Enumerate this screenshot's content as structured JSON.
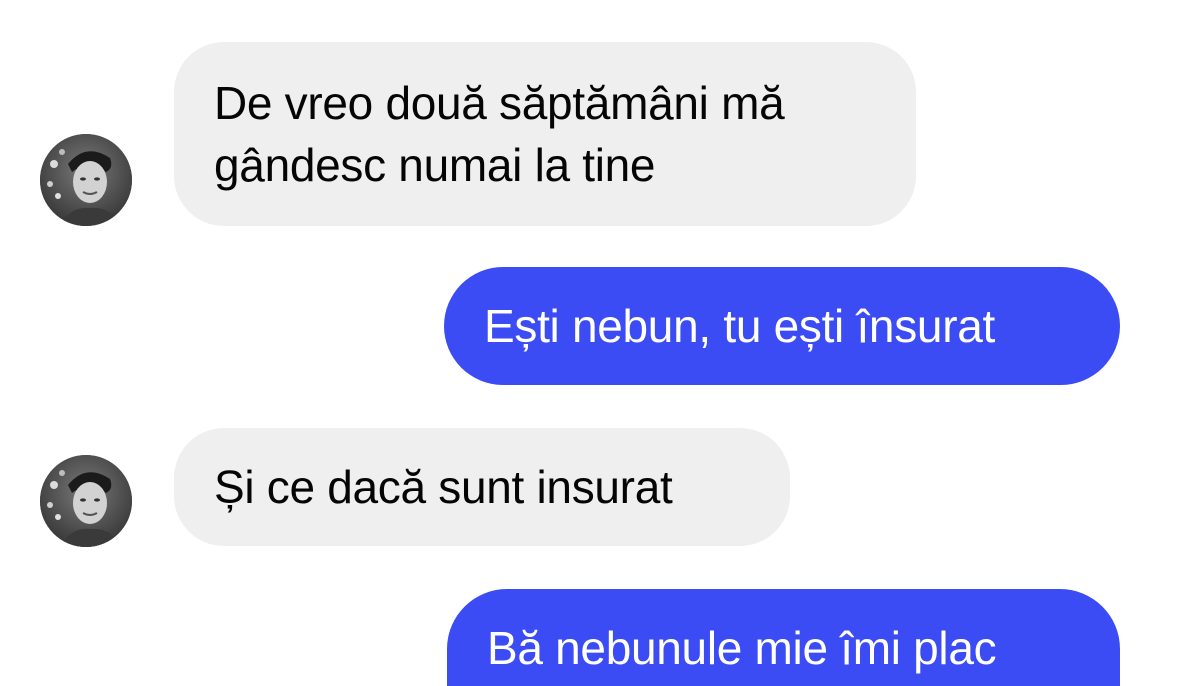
{
  "colors": {
    "incoming_bubble": "#efefef",
    "outgoing_bubble": "#3b4cf5",
    "incoming_text": "#050505",
    "outgoing_text": "#ffffff",
    "background": "#ffffff"
  },
  "messages": [
    {
      "direction": "incoming",
      "lines": [
        "De vreo două săptămâni mă",
        "gândesc numai la tine"
      ]
    },
    {
      "direction": "outgoing",
      "lines": [
        "Ești nebun, tu ești însurat"
      ]
    },
    {
      "direction": "incoming",
      "lines": [
        "Și ce dacă sunt insurat"
      ]
    },
    {
      "direction": "outgoing",
      "lines": [
        "Bă nebunule mie îmi plac"
      ]
    }
  ],
  "avatar_icon": "contact-avatar-icon"
}
